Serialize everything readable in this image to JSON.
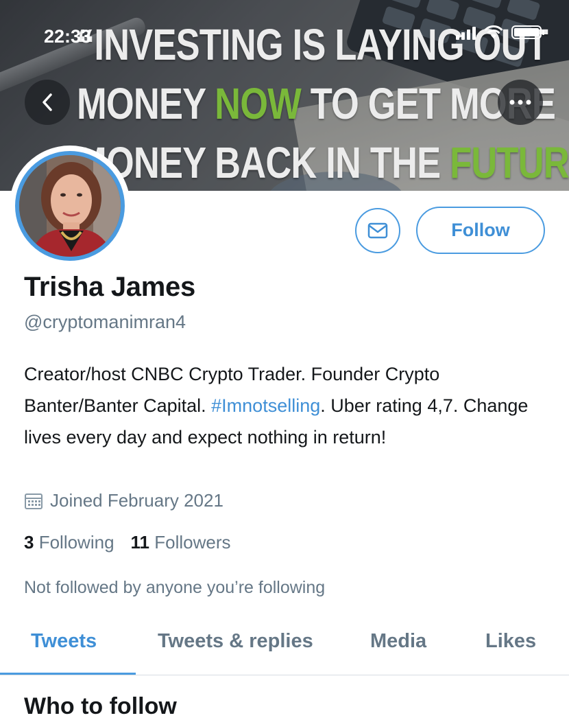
{
  "status_bar": {
    "time": "22:33"
  },
  "banner": {
    "quote_lines": [
      [
        {
          "text": "“INVESTING IS LAYING OUT",
          "green": false
        }
      ],
      [
        {
          "text": "MONEY ",
          "green": false
        },
        {
          "text": "NOW",
          "green": true
        },
        {
          "text": " TO GET MORE",
          "green": false
        }
      ],
      [
        {
          "text": "MONEY BACK IN THE ",
          "green": false
        },
        {
          "text": "FUTURE",
          "green": true
        },
        {
          "text": ".”",
          "green": false
        }
      ]
    ],
    "accent_color": "#7ab83a"
  },
  "profile": {
    "name": "Trisha James",
    "handle": "@cryptomanimran4",
    "bio_before": "Creator/host CNBC Crypto Trader. Founder Crypto Banter/Banter Capital. ",
    "bio_hashtag": "#Imnotselling",
    "bio_after": ". Uber rating 4,7. Change lives every day and expect nothing in return!",
    "joined": "Joined February 2021",
    "following_count": "3",
    "following_label": "Following",
    "followers_count": "11",
    "followers_label": "Followers",
    "not_followed": "Not followed by anyone you’re following"
  },
  "actions": {
    "follow_label": "Follow"
  },
  "tabs": [
    {
      "label": "Tweets",
      "active": true
    },
    {
      "label": "Tweets & replies",
      "active": false
    },
    {
      "label": "Media",
      "active": false
    },
    {
      "label": "Likes",
      "active": false
    }
  ],
  "section": {
    "who_to_follow": "Who to follow"
  },
  "colors": {
    "link_blue": "#3f8fd6",
    "muted": "#657786",
    "text": "#14171a"
  }
}
